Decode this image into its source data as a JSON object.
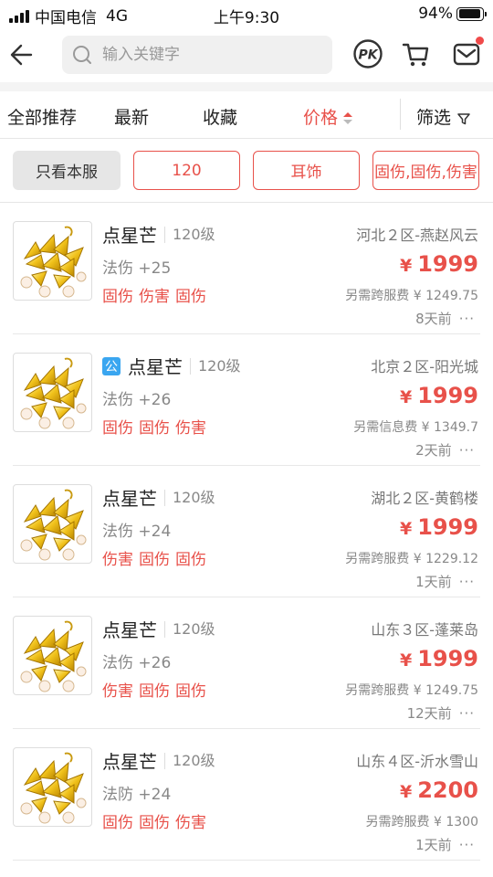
{
  "status_bar": {
    "carrier": "中国电信",
    "network": "4G",
    "time": "上午9:30",
    "battery": "94%",
    "battery_level": 0.94
  },
  "search": {
    "placeholder": "输入关键字",
    "icons": [
      "back-arrow-icon",
      "search-icon",
      "pk-icon",
      "cart-icon",
      "mail-icon"
    ]
  },
  "sort": {
    "all": "全部推荐",
    "latest": "最新",
    "favorites": "收藏",
    "price": "价格",
    "filter": "筛选",
    "active": "price"
  },
  "chips": {
    "server_only": "只看本服",
    "level": "120",
    "type": "耳饰",
    "attrs": "固伤,固伤,伤害"
  },
  "colors": {
    "accent": "#e8514a",
    "gov_badge": "#3aa6f0"
  },
  "items": [
    {
      "name": "点星芒",
      "level": "120级",
      "stat": "法伤 +25",
      "tags": [
        "固伤",
        "伤害",
        "固伤"
      ],
      "server": "河北２区-燕赵风云",
      "currency": "¥",
      "price": "1999",
      "fee": "另需跨服费 ¥ 1249.75",
      "time": "8天前",
      "badge": ""
    },
    {
      "name": "点星芒",
      "level": "120级",
      "stat": "法伤 +26",
      "tags": [
        "固伤",
        "固伤",
        "伤害"
      ],
      "server": "北京２区-阳光城",
      "currency": "¥",
      "price": "1999",
      "fee": "另需信息费 ¥ 1349.7",
      "time": "2天前",
      "badge": "公"
    },
    {
      "name": "点星芒",
      "level": "120级",
      "stat": "法伤 +24",
      "tags": [
        "伤害",
        "固伤",
        "固伤"
      ],
      "server": "湖北２区-黄鹤楼",
      "currency": "¥",
      "price": "1999",
      "fee": "另需跨服费 ¥ 1229.12",
      "time": "1天前",
      "badge": ""
    },
    {
      "name": "点星芒",
      "level": "120级",
      "stat": "法伤 +26",
      "tags": [
        "伤害",
        "固伤",
        "固伤"
      ],
      "server": "山东３区-蓬莱岛",
      "currency": "¥",
      "price": "1999",
      "fee": "另需跨服费 ¥ 1249.75",
      "time": "12天前",
      "badge": ""
    },
    {
      "name": "点星芒",
      "level": "120级",
      "stat": "法防 +24",
      "tags": [
        "固伤",
        "固伤",
        "伤害"
      ],
      "server": "山东４区-沂水雪山",
      "currency": "¥",
      "price": "2200",
      "fee": "另需跨服费 ¥ 1300",
      "time": "1天前",
      "badge": ""
    }
  ],
  "more_label": "···"
}
